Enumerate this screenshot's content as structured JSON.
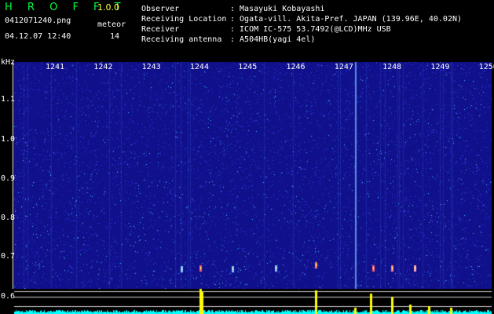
{
  "header": {
    "app_name": "H R O F F T",
    "version": "1.0.0",
    "filename": "0412071240.png",
    "datetime": "04.12.07 12:40",
    "meteor_label": "meteor",
    "meteor_count": "14"
  },
  "station": [
    {
      "key": "Observer",
      "value": ": Masayuki Kobayashi"
    },
    {
      "key": "Receiving Location",
      "value": ": Ogata-vill. Akita-Pref. JAPAN (139.96E, 40.02N)"
    },
    {
      "key": "Receiver",
      "value": ": ICOM IC-575 53.7492(@LCD)MHz USB"
    },
    {
      "key": "Receiving antenna",
      "value": ": A504HB(yagi 4el)"
    }
  ],
  "axis": {
    "unit": "kHz",
    "y_ticks": [
      "1.1",
      "1.0",
      "0.9",
      "0.8",
      "0.7",
      "0.6"
    ],
    "x_ticks": [
      "1241",
      "1242",
      "1243",
      "1244",
      "1245",
      "1246",
      "1247",
      "1248",
      "1249",
      "1250"
    ]
  },
  "colors": {
    "spectrogram_bg": "#10108a",
    "signal": "#ffff00",
    "noise": "#00ffff"
  }
}
